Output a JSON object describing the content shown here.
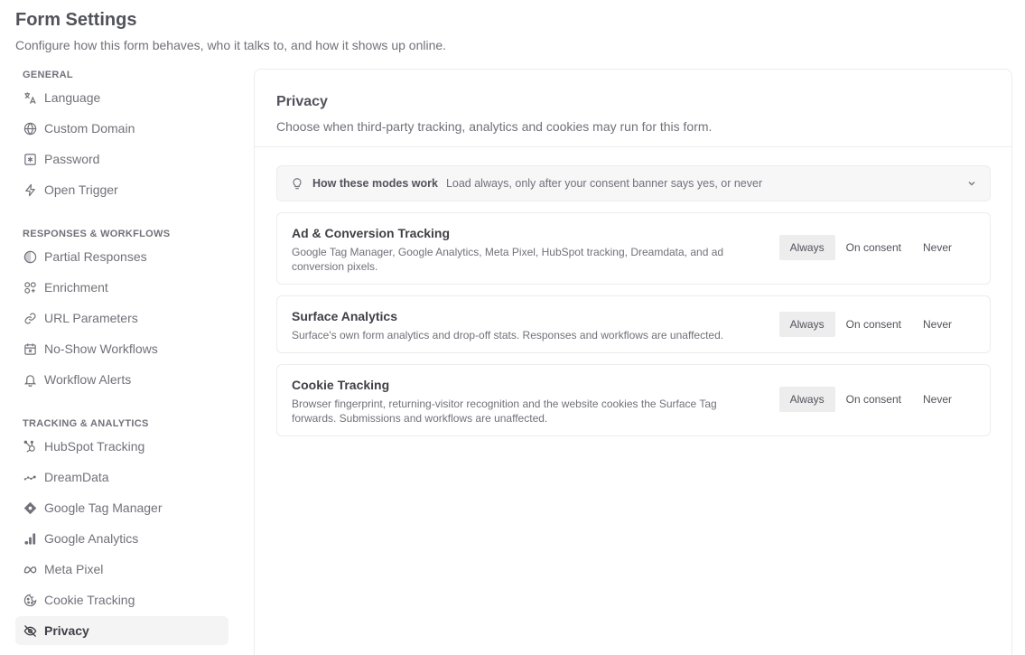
{
  "page": {
    "title": "Form Settings",
    "subtitle": "Configure how this form behaves, who it talks to, and how it shows up online."
  },
  "sidebar": {
    "general": {
      "label": "GENERAL",
      "items": [
        {
          "label": "Language",
          "icon": "language-icon"
        },
        {
          "label": "Custom Domain",
          "icon": "globe-icon"
        },
        {
          "label": "Password",
          "icon": "password-icon"
        },
        {
          "label": "Open Trigger",
          "icon": "bolt-icon"
        }
      ]
    },
    "responses": {
      "label": "RESPONSES & WORKFLOWS",
      "items": [
        {
          "label": "Partial Responses",
          "icon": "half-circle-icon"
        },
        {
          "label": "Enrichment",
          "icon": "enrichment-icon"
        },
        {
          "label": "URL Parameters",
          "icon": "link-icon"
        },
        {
          "label": "No-Show Workflows",
          "icon": "calendar-x-icon"
        },
        {
          "label": "Workflow Alerts",
          "icon": "bell-icon"
        }
      ]
    },
    "tracking": {
      "label": "TRACKING & ANALYTICS",
      "items": [
        {
          "label": "HubSpot Tracking",
          "icon": "hubspot-icon"
        },
        {
          "label": "DreamData",
          "icon": "dreamdata-icon"
        },
        {
          "label": "Google Tag Manager",
          "icon": "gtm-icon"
        },
        {
          "label": "Google Analytics",
          "icon": "analytics-bars-icon"
        },
        {
          "label": "Meta Pixel",
          "icon": "meta-icon"
        },
        {
          "label": "Cookie Tracking",
          "icon": "cookie-icon"
        },
        {
          "label": "Privacy",
          "icon": "eye-off-icon"
        }
      ]
    }
  },
  "panel": {
    "title": "Privacy",
    "description": "Choose when third-party tracking, analytics and cookies may run for this form.",
    "info": {
      "title": "How these modes work",
      "text": "Load always, only after your consent banner says yes, or never"
    },
    "settings": [
      {
        "title": "Ad & Conversion Tracking",
        "description": "Google Tag Manager, Google Analytics, Meta Pixel, HubSpot tracking, Dreamdata, and ad conversion pixels.",
        "selected": "Always"
      },
      {
        "title": "Surface Analytics",
        "description": "Surface's own form analytics and drop-off stats. Responses and workflows are unaffected.",
        "selected": "Always"
      },
      {
        "title": "Cookie Tracking",
        "description": "Browser fingerprint, returning-visitor recognition and the website cookies the Surface Tag forwards. Submissions and workflows are unaffected.",
        "selected": "Always"
      }
    ],
    "options": {
      "always": "Always",
      "consent": "On consent",
      "never": "Never"
    }
  }
}
